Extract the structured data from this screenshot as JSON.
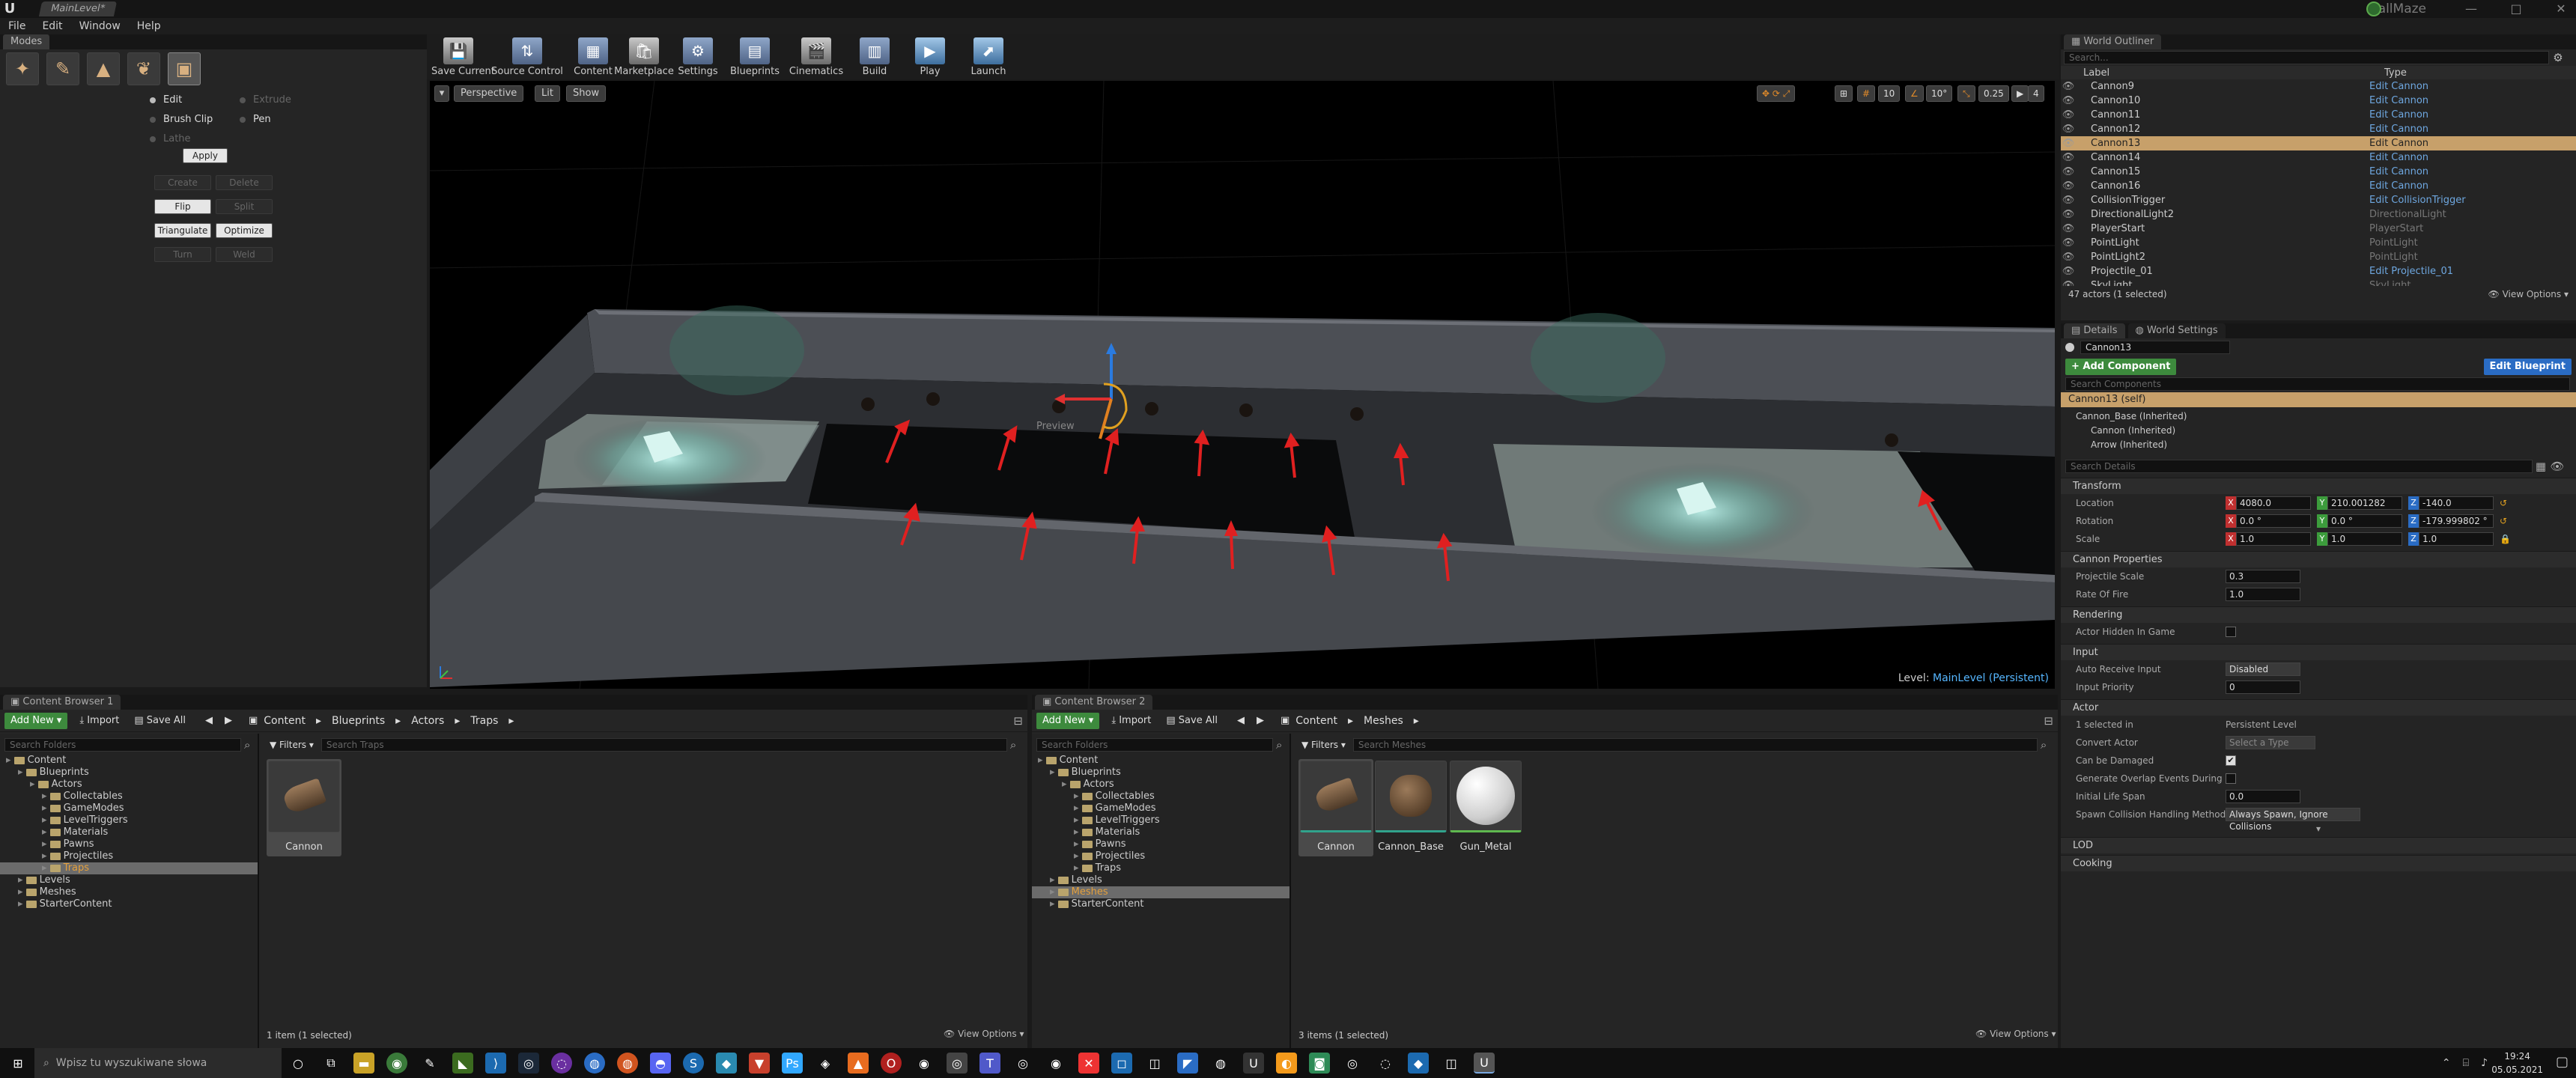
{
  "window": {
    "tab": "MainLevel*",
    "project": "BallMaze",
    "controls": [
      "—",
      "□",
      "✕"
    ]
  },
  "menu": [
    "File",
    "Edit",
    "Window",
    "Help"
  ],
  "modes": {
    "tab": "Modes",
    "radios": [
      {
        "label": "Edit",
        "on": true
      },
      {
        "label": "Extrude",
        "on": false
      },
      {
        "label": "Brush Clip",
        "on": false
      },
      {
        "label": "Pen",
        "on": false
      },
      {
        "label": "Lathe",
        "on": false
      }
    ],
    "apply": "Apply",
    "buttons": [
      [
        "Create",
        "Delete"
      ],
      [
        "Flip",
        "Split"
      ],
      [
        "Triangulate",
        "Optimize"
      ],
      [
        "Turn",
        "Weld"
      ]
    ]
  },
  "toolbar": [
    "Save Current",
    "Source Control",
    "Content",
    "Marketplace",
    "Settings",
    "Blueprints",
    "Cinematics",
    "Build",
    "Play",
    "Launch"
  ],
  "viewport": {
    "perspective": "Perspective",
    "lit": "Lit",
    "show": "Show",
    "right_vals": [
      "10",
      "10°",
      "0.25",
      "4"
    ],
    "level_label": "Level:",
    "level_name": "MainLevel (Persistent)"
  },
  "outliner": {
    "tab": "World Outliner",
    "search_placeholder": "Search...",
    "col_label": "Label",
    "col_type": "Type",
    "rows": [
      {
        "name": "Cannon9",
        "type": "Edit Cannon",
        "link": true
      },
      {
        "name": "Cannon10",
        "type": "Edit Cannon",
        "link": true
      },
      {
        "name": "Cannon11",
        "type": "Edit Cannon",
        "link": true
      },
      {
        "name": "Cannon12",
        "type": "Edit Cannon",
        "link": true
      },
      {
        "name": "Cannon13",
        "type": "Edit Cannon",
        "link": true,
        "selected": true
      },
      {
        "name": "Cannon14",
        "type": "Edit Cannon",
        "link": true
      },
      {
        "name": "Cannon15",
        "type": "Edit Cannon",
        "link": true
      },
      {
        "name": "Cannon16",
        "type": "Edit Cannon",
        "link": true
      },
      {
        "name": "CollisionTrigger",
        "type": "Edit CollisionTrigger",
        "link": true
      },
      {
        "name": "DirectionalLight2",
        "type": "DirectionalLight",
        "link": false
      },
      {
        "name": "PlayerStart",
        "type": "PlayerStart",
        "link": false
      },
      {
        "name": "PointLight",
        "type": "PointLight",
        "link": false
      },
      {
        "name": "PointLight2",
        "type": "PointLight",
        "link": false
      },
      {
        "name": "Projectile_01",
        "type": "Edit Projectile_01",
        "link": true
      },
      {
        "name": "SkyLight",
        "type": "SkyLight",
        "link": false
      }
    ],
    "count": "47 actors (1 selected)",
    "view_options": "View Options"
  },
  "details": {
    "tabs": [
      "Details",
      "World Settings"
    ],
    "name": "Cannon13",
    "add_component": "+ Add Component",
    "edit_blueprint": "Edit Blueprint",
    "search_components": "Search Components",
    "self": "Cannon13 (self)",
    "components": [
      "Cannon_Base (Inherited)",
      "Cannon (Inherited)",
      "Arrow (Inherited)"
    ],
    "search_details": "Search Details",
    "transform": "Transform",
    "location_label": "Location",
    "location": [
      "4080.0",
      "210.001282",
      "-140.0"
    ],
    "rotation_label": "Rotation",
    "rotation": [
      "0.0 °",
      "0.0 °",
      "-179.999802 °"
    ],
    "scale_label": "Scale",
    "scale": [
      "1.0",
      "1.0",
      "1.0"
    ],
    "cannon_props": "Cannon Properties",
    "projectile_scale_label": "Projectile Scale",
    "projectile_scale": "0.3",
    "rate_of_fire_label": "Rate Of Fire",
    "rate_of_fire": "1.0",
    "rendering": "Rendering",
    "hidden_label": "Actor Hidden In Game",
    "input": "Input",
    "auto_receive_label": "Auto Receive Input",
    "auto_receive": "Disabled",
    "input_priority_label": "Input Priority",
    "input_priority": "0",
    "actor": "Actor",
    "selected_in_label": "1 selected in",
    "selected_in": "Persistent Level",
    "convert_label": "Convert Actor",
    "convert": "Select a Type",
    "damaged_label": "Can be Damaged",
    "overlap_label": "Generate Overlap Events During Level Streaming",
    "lifespan_label": "Initial Life Span",
    "lifespan": "0.0",
    "spawn_label": "Spawn Collision Handling Method",
    "spawn": "Always Spawn, Ignore Collisions",
    "lod": "LOD",
    "cooking": "Cooking"
  },
  "cb1": {
    "tab": "Content Browser 1",
    "add_new": "Add New",
    "import": "Import",
    "save_all": "Save All",
    "path": [
      "Content",
      "Blueprints",
      "Actors",
      "Traps"
    ],
    "search_folders": "Search Folders",
    "filters": "Filters",
    "search_assets": "Search Traps",
    "tree": [
      {
        "label": "Content",
        "depth": 0
      },
      {
        "label": "Blueprints",
        "depth": 1
      },
      {
        "label": "Actors",
        "depth": 2
      },
      {
        "label": "Collectables",
        "depth": 3
      },
      {
        "label": "GameModes",
        "depth": 3
      },
      {
        "label": "LevelTriggers",
        "depth": 3
      },
      {
        "label": "Materials",
        "depth": 3
      },
      {
        "label": "Pawns",
        "depth": 3
      },
      {
        "label": "Projectiles",
        "depth": 3
      },
      {
        "label": "Traps",
        "depth": 3,
        "selected": true
      },
      {
        "label": "Levels",
        "depth": 1
      },
      {
        "label": "Meshes",
        "depth": 1
      },
      {
        "label": "StarterContent",
        "depth": 1
      }
    ],
    "assets": [
      "Cannon"
    ],
    "count": "1 item (1 selected)",
    "view_options": "View Options"
  },
  "cb2": {
    "tab": "Content Browser 2",
    "add_new": "Add New",
    "import": "Import",
    "save_all": "Save All",
    "path": [
      "Content",
      "Meshes"
    ],
    "search_folders": "Search Folders",
    "filters": "Filters",
    "search_assets": "Search Meshes",
    "tree": [
      {
        "label": "Content",
        "depth": 0
      },
      {
        "label": "Blueprints",
        "depth": 1
      },
      {
        "label": "Actors",
        "depth": 2
      },
      {
        "label": "Collectables",
        "depth": 3
      },
      {
        "label": "GameModes",
        "depth": 3
      },
      {
        "label": "LevelTriggers",
        "depth": 3
      },
      {
        "label": "Materials",
        "depth": 3
      },
      {
        "label": "Pawns",
        "depth": 3
      },
      {
        "label": "Projectiles",
        "depth": 3
      },
      {
        "label": "Traps",
        "depth": 3
      },
      {
        "label": "Levels",
        "depth": 1
      },
      {
        "label": "Meshes",
        "depth": 1,
        "selected": true
      },
      {
        "label": "StarterContent",
        "depth": 1
      }
    ],
    "assets": [
      "Cannon",
      "Cannon_Base",
      "Gun_Metal"
    ],
    "count": "3 items (1 selected)",
    "view_options": "View Options"
  },
  "taskbar": {
    "search_placeholder": "Wpisz tu wyszukiwane słowa",
    "time": "19:24",
    "date": "05.05.2021"
  },
  "colors": {
    "accent": "#c7a06a",
    "link": "#6ea7e0",
    "green": "#3d8a3d",
    "blue": "#2a6cc4"
  }
}
